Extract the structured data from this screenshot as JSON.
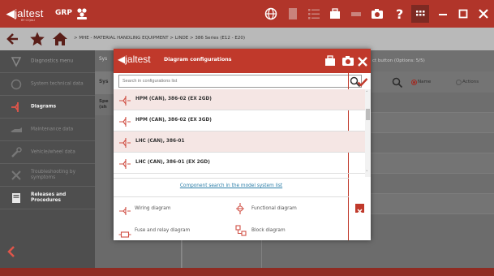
{
  "app": {
    "logo": "jaltest",
    "logo_sub": "BY COJALI",
    "group": "GRP"
  },
  "breadcrumb": "> MHE - MATERIAL HANDLING EQUIPMENT > LINDE > 386 Series (E12 - E20)",
  "sidebar": {
    "items": [
      {
        "label": "Diagnostics menu",
        "icon": "diagnostics-icon",
        "active": false
      },
      {
        "label": "System technical data",
        "icon": "technical-data-icon",
        "active": false
      },
      {
        "label": "Diagrams",
        "icon": "diagram-icon",
        "active": true
      },
      {
        "label": "Maintenance data",
        "icon": "oil-can-icon",
        "active": false
      },
      {
        "label": "Vehicle/wheel data",
        "icon": "wrench-icon",
        "active": false
      },
      {
        "label": "Troubleshooting by symptoms",
        "icon": "tools-icon",
        "active": false
      },
      {
        "label": "Releases and Procedures",
        "icon": "book-icon",
        "active": true
      }
    ]
  },
  "background": {
    "col1_label": "Sys",
    "col1_sub": "Sys",
    "col1_row": "Spe",
    "col1_row2": "(sh",
    "filter_text": "ct button (Options: 5/5)",
    "radio_name": "Name",
    "radio_actions": "Actions"
  },
  "modal": {
    "title": "Diagram configurations",
    "search_placeholder": "Search in configurations list",
    "rows": [
      {
        "label": "HPM (CAN), 386-02 (EX 2GD)"
      },
      {
        "label": "HPM (CAN), 386-02 (EX 3GD)"
      },
      {
        "label": "LHC (CAN), 386-01"
      },
      {
        "label": "LHC (CAN), 386-01 (EX 2GD)"
      }
    ],
    "component_link": "Component search in the model system list",
    "legend": {
      "wiring": "Wiring diagram",
      "functional": "Functional diagram",
      "fuse": "Fuse and relay diagram",
      "block": "Block diagram"
    }
  },
  "colors": {
    "accent": "#c0392b",
    "topbar": "#b1352a",
    "sidebar": "#4e4e4e"
  }
}
